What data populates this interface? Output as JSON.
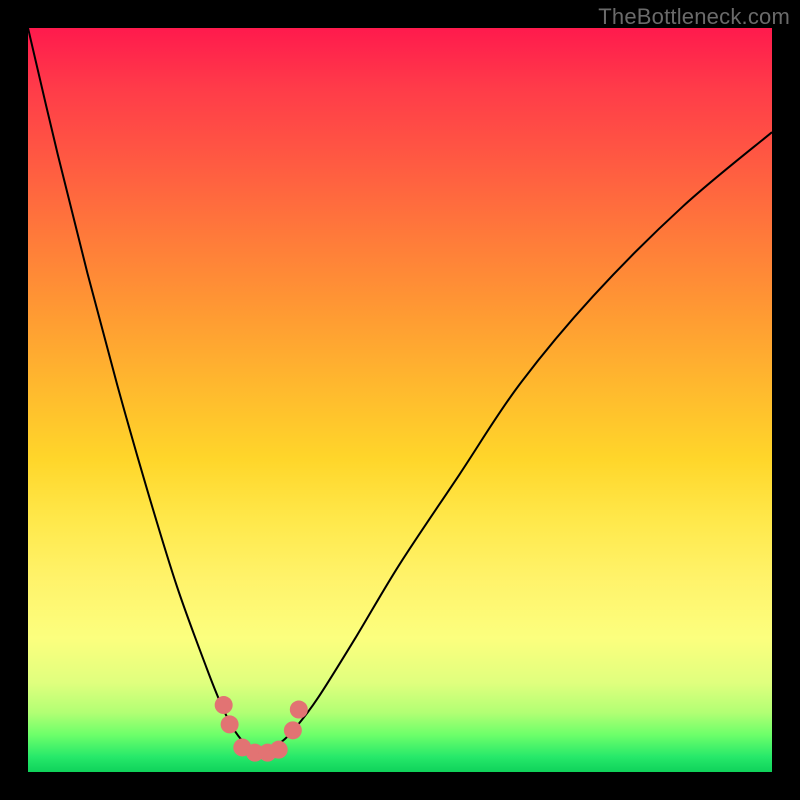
{
  "watermark": "TheBottleneck.com",
  "chart_data": {
    "type": "line",
    "title": "",
    "xlabel": "",
    "ylabel": "",
    "xlim": [
      0,
      100
    ],
    "ylim": [
      0,
      100
    ],
    "series": [
      {
        "name": "bottleneck-curve",
        "x": [
          0,
          4,
          8,
          12,
          16,
          20,
          24,
          26,
          27.5,
          29,
          30.5,
          32,
          34,
          36,
          39,
          44,
          50,
          58,
          66,
          76,
          88,
          100
        ],
        "y": [
          100,
          83,
          67,
          52,
          38,
          25,
          14,
          9,
          6,
          4,
          3,
          3,
          4,
          6,
          10,
          18,
          28,
          40,
          52,
          64,
          76,
          86
        ]
      }
    ],
    "markers": {
      "name": "highlighted-points",
      "color": "#e27373",
      "points": [
        {
          "x": 26.3,
          "y": 9.0
        },
        {
          "x": 27.1,
          "y": 6.4
        },
        {
          "x": 28.8,
          "y": 3.3
        },
        {
          "x": 30.5,
          "y": 2.6
        },
        {
          "x": 32.2,
          "y": 2.6
        },
        {
          "x": 33.7,
          "y": 3.0
        },
        {
          "x": 35.6,
          "y": 5.6
        },
        {
          "x": 36.4,
          "y": 8.4
        }
      ]
    },
    "background_gradient": {
      "top": "#ff1a4d",
      "mid": "#ffe84a",
      "bottom": "#0fd25a"
    }
  }
}
